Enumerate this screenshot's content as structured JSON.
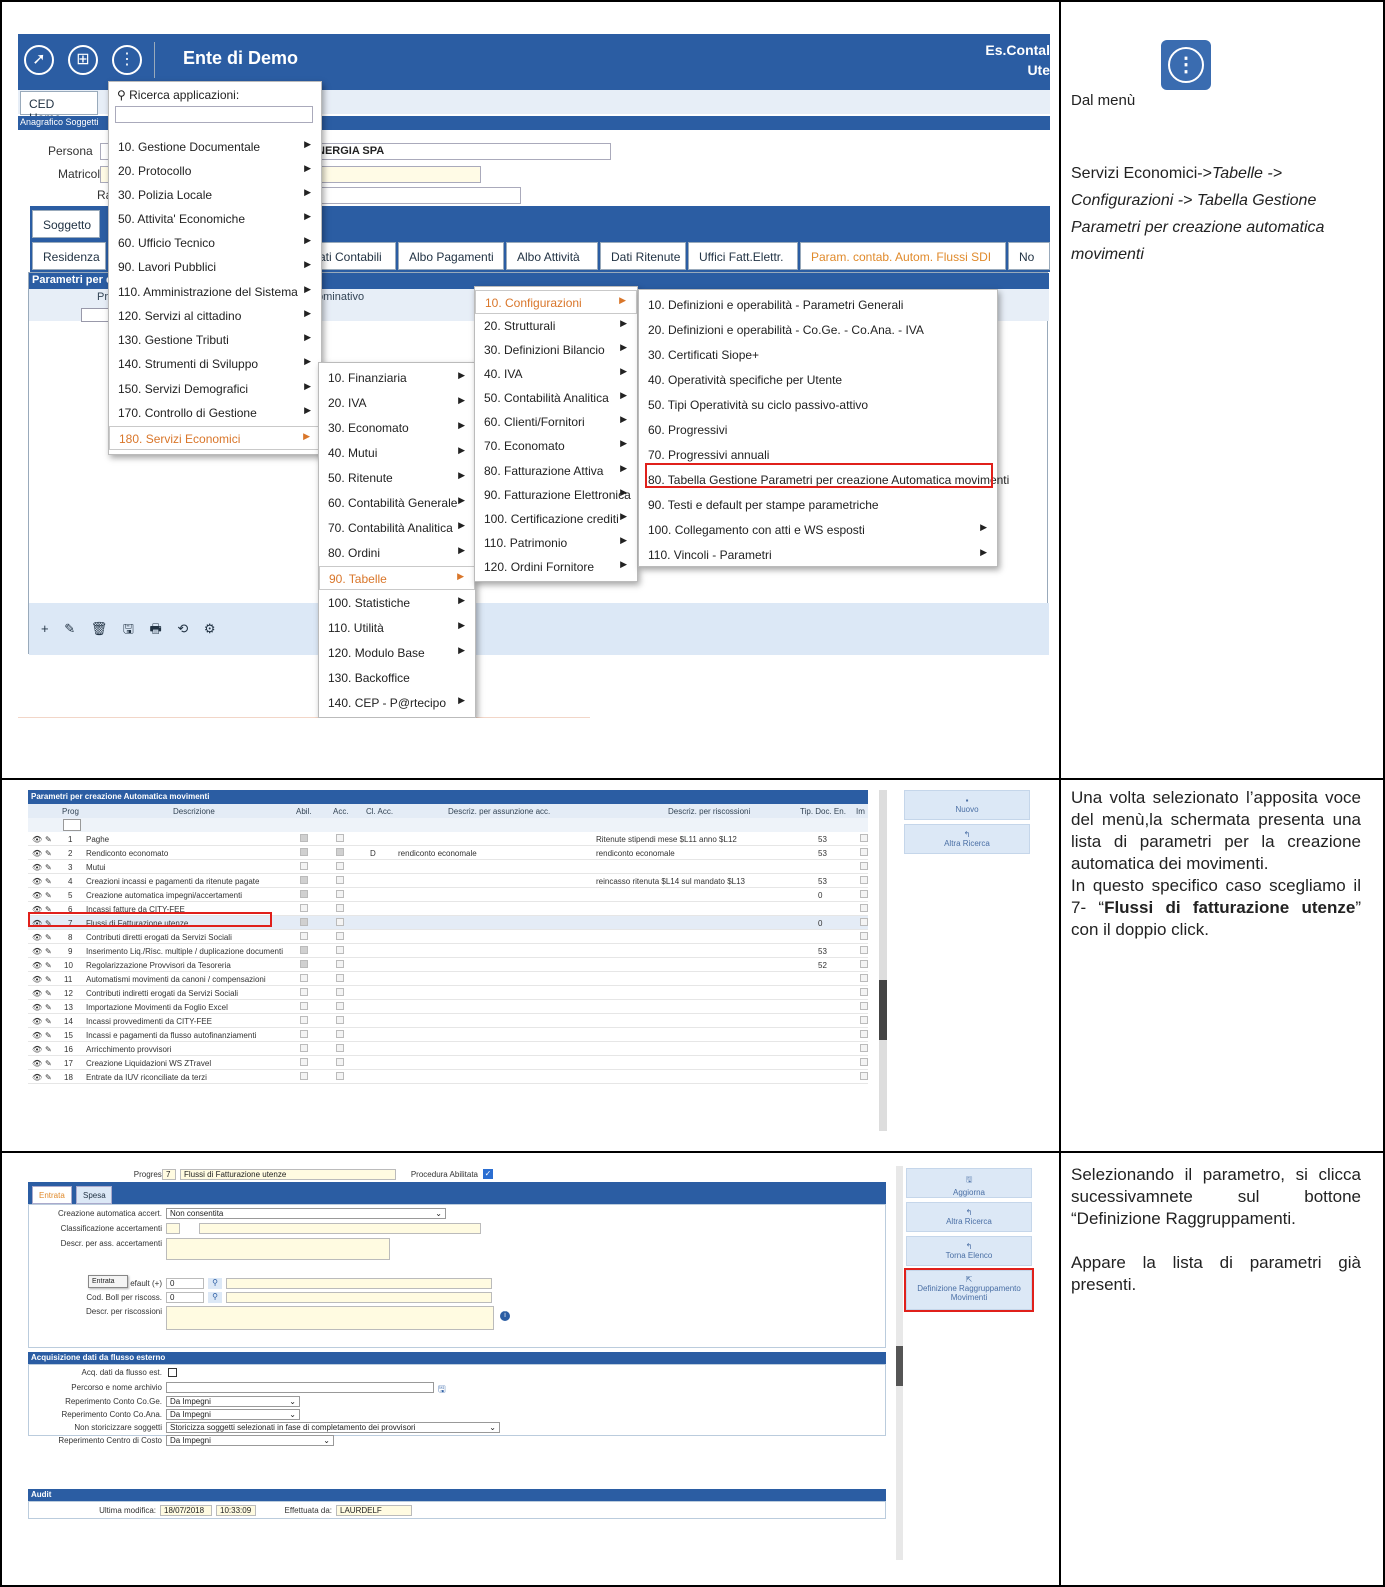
{
  "app": {
    "title": "Ente di Demo",
    "es_text_1": "Es.Contal",
    "es_text_2": "Ute",
    "home_tab": "CED Home",
    "section_label": "Anagrafico Soggetti"
  },
  "form": {
    "persona_label": "Persona",
    "persona_value": "NERGIA SPA",
    "matricola_label": "Matricola",
    "ra_label": "Ra",
    "soggetto_tab": "Soggetto"
  },
  "subtabs": [
    "Residenza",
    "ati Contabili",
    "Albo Pagamenti",
    "Albo Attività",
    "Dati Ritenute",
    "Uffici Fatt.Elettr.",
    "Param. contab. Autom. Flussi SDI",
    "No"
  ],
  "panel": {
    "title": "Parametri per c",
    "col_pr": "Pr",
    "col_nominativo": "ominativo",
    "toolbar": "+ ✎ 🗑 🖫 🖶 ⟲ ⚙"
  },
  "menu1": {
    "search_label": "Ricerca applicazioni:",
    "items": [
      "10. Gestione Documentale",
      "20. Protocollo",
      "30. Polizia Locale",
      "50. Attivita' Economiche",
      "60. Ufficio Tecnico",
      "90. Lavori Pubblici",
      "110. Amministrazione del Sistema",
      "120. Servizi al cittadino",
      "130. Gestione Tributi",
      "140. Strumenti di Sviluppo",
      "150. Servizi Demografici",
      "170. Controllo di Gestione",
      "180. Servizi Economici"
    ]
  },
  "menu2": {
    "items": [
      "10. Finanziaria",
      "20. IVA",
      "30. Economato",
      "40. Mutui",
      "50. Ritenute",
      "60. Contabilità Generale",
      "70. Contabilità Analitica",
      "80. Ordini",
      "90. Tabelle",
      "100. Statistiche",
      "110. Utilità",
      "120. Modulo Base",
      "130. Backoffice",
      "140. CEP - P@rtecipo"
    ]
  },
  "menu3": {
    "items": [
      "10. Configurazioni",
      "20. Strutturali",
      "30. Definizioni Bilancio",
      "40. IVA",
      "50. Contabilità Analitica",
      "60. Clienti/Fornitori",
      "70. Economato",
      "80. Fatturazione Attiva",
      "90. Fatturazione Elettronica",
      "100. Certificazione crediti",
      "110. Patrimonio",
      "120. Ordini Fornitore"
    ]
  },
  "menu4": {
    "items": [
      "10. Definizioni e operabilità - Parametri Generali",
      "20. Definizioni e operabilità - Co.Ge. - Co.Ana. - IVA",
      "30. Certificati Siope+",
      "40. Operatività specifiche per Utente",
      "50. Tipi Operatività su ciclo passivo-attivo",
      "60. Progressivi",
      "70. Progressivi annuali",
      "80. Tabella Gestione Parametri per creazione Automatica movimenti",
      "90. Testi e default per stampe parametriche",
      "100. Collegamento con atti e WS esposti",
      "110. Vincoli - Parametri"
    ]
  },
  "desc1": {
    "line1": "Dal menù",
    "line2": "Servizi Economici->",
    "line2_it": "Tabelle -> Configurazioni -> Tabella Gestione Parametri per creazione automatica movimenti"
  },
  "list": {
    "title": "Parametri per creazione Automatica movimenti",
    "headers": [
      "Prog",
      "Descrizione",
      "Abil.",
      "Acc.",
      "Cl. Acc.",
      "Descriz. per assunzione acc.",
      "Descriz. per riscossioni",
      "Tip. Doc. En.",
      "Im"
    ],
    "rows": [
      {
        "n": "1",
        "d": "Paghe",
        "cl": "",
        "acc": "",
        "risc": "Ritenute stipendi mese $L11 anno $L12",
        "tip": "53"
      },
      {
        "n": "2",
        "d": "Rendiconto economato",
        "cl": "D",
        "acc": "rendiconto economale",
        "risc": "rendiconto economale",
        "tip": "53"
      },
      {
        "n": "3",
        "d": "Mutui",
        "cl": "",
        "acc": "",
        "risc": "",
        "tip": ""
      },
      {
        "n": "4",
        "d": "Creazioni incassi e pagamenti da ritenute pagate",
        "cl": "",
        "acc": "",
        "risc": "reincasso ritenuta $L14 sul mandato $L13",
        "tip": "53"
      },
      {
        "n": "5",
        "d": "Creazione automatica impegni/accertamenti",
        "cl": "",
        "acc": "",
        "risc": "",
        "tip": "0"
      },
      {
        "n": "6",
        "d": "Incassi fatture da CITY-FEE",
        "cl": "",
        "acc": "",
        "risc": "",
        "tip": ""
      },
      {
        "n": "7",
        "d": "Flussi di Fatturazione utenze",
        "cl": "",
        "acc": "",
        "risc": "",
        "tip": "0"
      },
      {
        "n": "8",
        "d": "Contributi diretti erogati da Servizi Sociali",
        "cl": "",
        "acc": "",
        "risc": "",
        "tip": ""
      },
      {
        "n": "9",
        "d": "Inserimento Liq./Risc. multiple / duplicazione documenti",
        "cl": "",
        "acc": "",
        "risc": "",
        "tip": "53"
      },
      {
        "n": "10",
        "d": "Regolarizzazione Provvisori da Tesoreria",
        "cl": "",
        "acc": "",
        "risc": "",
        "tip": "52"
      },
      {
        "n": "11",
        "d": "Automatismi movimenti da canoni / compensazioni",
        "cl": "",
        "acc": "",
        "risc": "",
        "tip": ""
      },
      {
        "n": "12",
        "d": "Contributi indiretti erogati da Servizi Sociali",
        "cl": "",
        "acc": "",
        "risc": "",
        "tip": ""
      },
      {
        "n": "13",
        "d": "Importazione Movimenti da Foglio Excel",
        "cl": "",
        "acc": "",
        "risc": "",
        "tip": ""
      },
      {
        "n": "14",
        "d": "Incassi provvedimenti da CITY-FEE",
        "cl": "",
        "acc": "",
        "risc": "",
        "tip": ""
      },
      {
        "n": "15",
        "d": "Incassi e pagamenti da flusso autofinanziamenti",
        "cl": "",
        "acc": "",
        "risc": "",
        "tip": ""
      },
      {
        "n": "16",
        "d": "Arricchimento provvisori",
        "cl": "",
        "acc": "",
        "risc": "",
        "tip": ""
      },
      {
        "n": "17",
        "d": "Creazione Liquidazioni WS ZTravel",
        "cl": "",
        "acc": "",
        "risc": "",
        "tip": ""
      },
      {
        "n": "18",
        "d": "Entrate da IUV riconciliate da terzi",
        "cl": "",
        "acc": "",
        "risc": "",
        "tip": ""
      }
    ],
    "btn_nuovo": "Nuovo",
    "btn_altra": "Altra Ricerca"
  },
  "desc2": {
    "text1": "Una volta selezionato l’apposita voce del menù,la schermata presenta una lista di parametri per la creazione automatica dei movimenti.",
    "text2a": "In questo specifico caso scegliamo il 7- “",
    "text2b": "Flussi di fatturazione utenze",
    "text2c": "” con il doppio click."
  },
  "detail": {
    "progressivo_label": "Progressivo",
    "progressivo_value": "7",
    "desc_value": "Flussi di Fatturazione utenze",
    "proc_label": "Procedura Abilitata",
    "tab_entrata": "Entrata",
    "tab_spesa": "Spesa",
    "creazione_label": "Creazione automatica accert.",
    "creazione_value": "Non consentita",
    "classif_label": "Classificazione accertamenti",
    "descr_ass_label": "Descr. per ass. accertamenti",
    "default_label": "efault (+)",
    "default_value": "0",
    "tooltip": "Entrata",
    "cod_label": "Cod. Boll per riscoss.",
    "cod_value": "0",
    "descr_risc_label": "Descr. per riscossioni",
    "acq_title": "Acquisizione dati da flusso esterno",
    "acq_label": "Acq. dati da flusso est.",
    "percorso_label": "Percorso e nome archivio",
    "cog_label": "Reperimento Conto Co.Ge.",
    "cog_value": "Da Impegni",
    "coana_label": "Reperimento Conto Co.Ana.",
    "coana_value": "Da Impegni",
    "nonstor_label": "Non storicizzare soggetti",
    "nonstor_value": "Storicizza soggetti selezionati in fase di completamento dei provvisori",
    "cdc_label": "Reperimento Centro di Costo",
    "cdc_value": "Da Impegni",
    "audit_title": "Audit",
    "ultima_label": "Ultima modifica:",
    "ultima_date": "18/07/2018",
    "ultima_time": "10:33:09",
    "eff_label": "Effettuata da:",
    "eff_value": "LAURDELF",
    "btn_aggiorna": "Aggiorna",
    "btn_altra": "Altra Ricerca",
    "btn_torna": "Torna Elenco",
    "btn_def": "Definizione Raggruppamento Movimenti"
  },
  "desc3": {
    "text1": "Selezionando il parametro, si clicca sucessivamnete sul bottone “Definizione Raggruppamenti.",
    "text2": "Appare la lista di parametri già presenti."
  }
}
